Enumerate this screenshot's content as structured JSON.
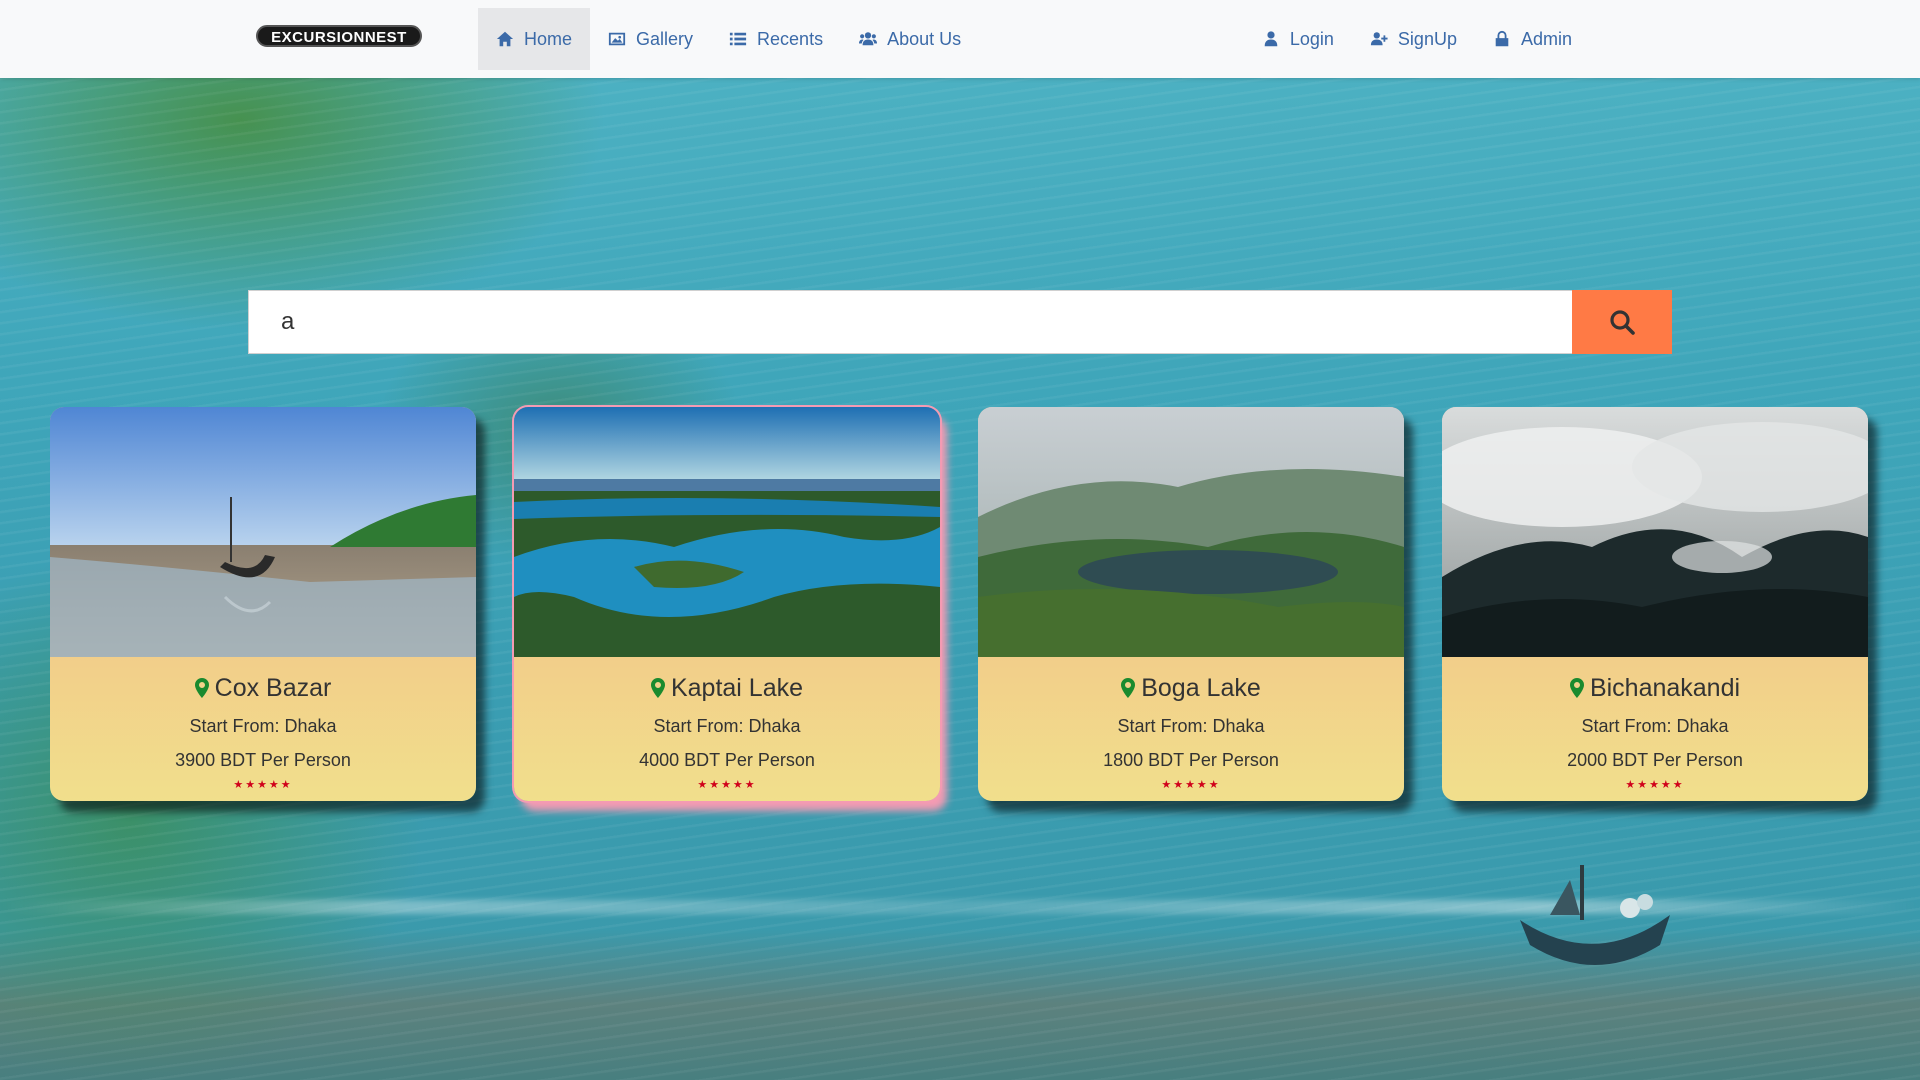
{
  "brand": "EXCURSIONNEST",
  "nav": {
    "left": [
      {
        "label": "Home",
        "icon": "home-icon",
        "active": true
      },
      {
        "label": "Gallery",
        "icon": "image-icon"
      },
      {
        "label": "Recents",
        "icon": "list-icon"
      },
      {
        "label": "About Us",
        "icon": "users-icon"
      }
    ],
    "right": [
      {
        "label": "Login",
        "icon": "user-icon"
      },
      {
        "label": "SignUp",
        "icon": "user-plus-icon"
      },
      {
        "label": "Admin",
        "icon": "lock-icon"
      }
    ]
  },
  "search": {
    "value": "a",
    "button_icon": "search-icon"
  },
  "colors": {
    "accent": "#ff7a45",
    "nav_link": "#3b6aa8",
    "pin": "#1a8a2e",
    "star": "#d0021b",
    "highlight": "#f49bb3"
  },
  "cards": [
    {
      "title": "Cox Bazar",
      "start": "Start From: Dhaka",
      "price": "3900 BDT Per Person",
      "stars": "★★★★★",
      "rating": 5
    },
    {
      "title": "Kaptai Lake",
      "start": "Start From: Dhaka",
      "price": "4000 BDT Per Person",
      "stars": "★★★★★",
      "rating": 5
    },
    {
      "title": "Boga Lake",
      "start": "Start From: Dhaka",
      "price": "1800 BDT Per Person",
      "stars": "★★★★★",
      "rating": 5
    },
    {
      "title": "Bichanakandi",
      "start": "Start From: Dhaka",
      "price": "2000 BDT Per Person",
      "stars": "★★★★★",
      "rating": 5
    }
  ]
}
